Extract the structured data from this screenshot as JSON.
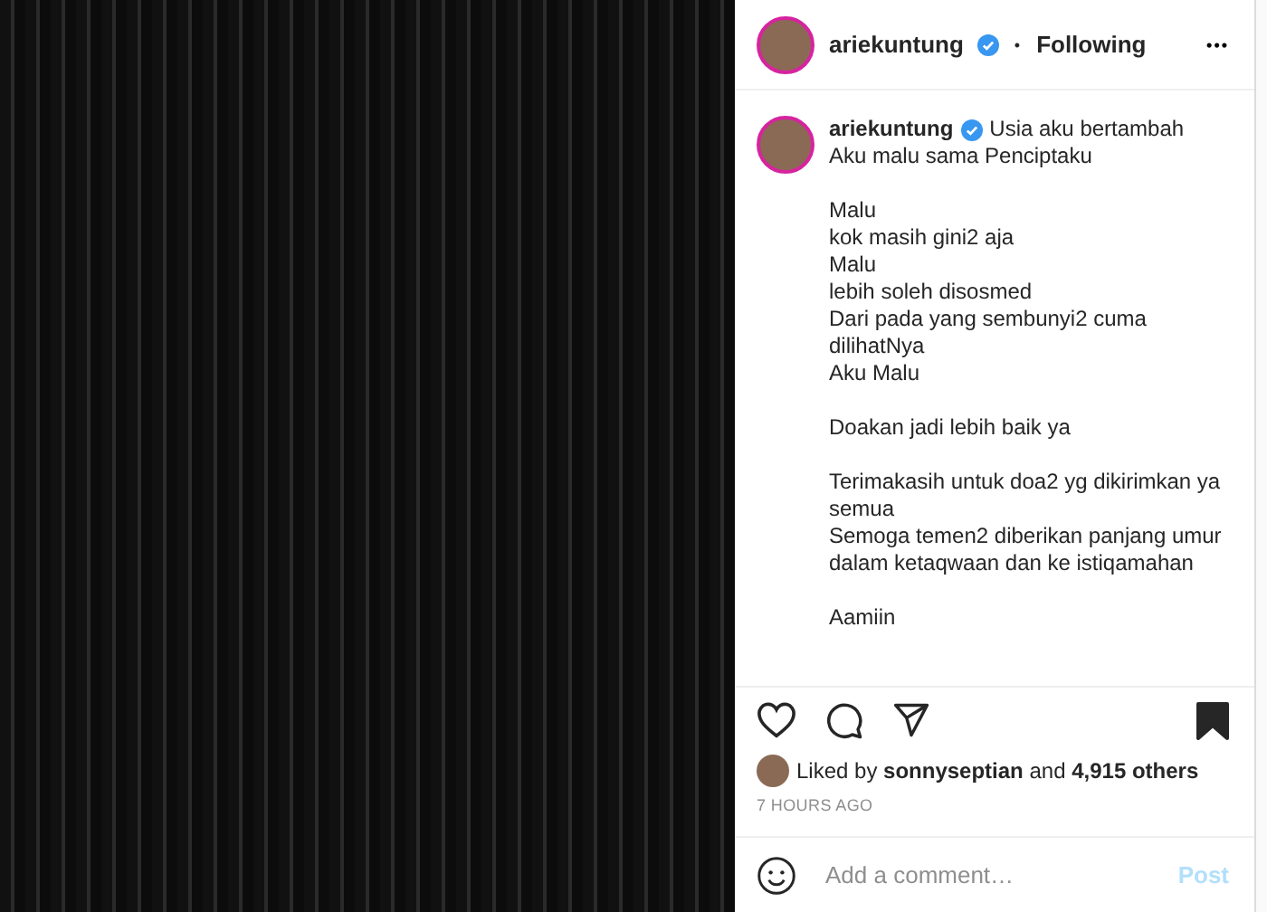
{
  "post_header": {
    "username": "ariekuntung",
    "verified": true,
    "separator": "•",
    "follow_label": "Following",
    "more": "•••"
  },
  "caption": {
    "username": "ariekuntung",
    "verified": true,
    "paragraphs": [
      [
        "Usia aku bertambah",
        "Aku malu sama Penciptaku"
      ],
      [
        "Malu",
        "kok masih gini2 aja",
        "Malu",
        "lebih soleh disosmed",
        "Dari pada yang sembunyi2 cuma dilihatNya",
        "Aku Malu"
      ],
      [
        "Doakan jadi lebih baik ya"
      ],
      [
        "Terimakasih untuk doa2 yg dikirimkan ya semua",
        "Semoga temen2 diberikan panjang umur dalam ketaqwaan dan ke istiqamahan"
      ],
      [
        "Aamiin"
      ]
    ]
  },
  "actions": {
    "liked": false,
    "saved": true
  },
  "likes": {
    "text": "Liked by **sonnyseptian** and **4,915 others**"
  },
  "timestamp": "7 HOURS AGO",
  "comment_box": {
    "placeholder": "Add a comment…",
    "post_label": "Post",
    "disabled": true
  }
}
